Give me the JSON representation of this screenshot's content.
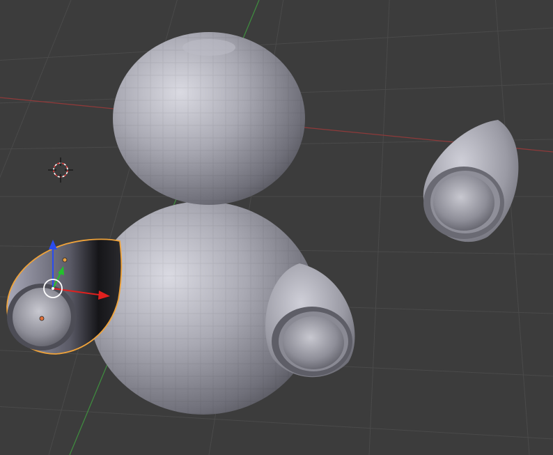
{
  "viewport": {
    "view": "3D Viewport",
    "colors": {
      "background": "#3c3c3c",
      "grid_line": "#4a4a4a",
      "axis_x": "#8e3a3a",
      "axis_y": "#3f8a3f",
      "mesh_light": "#c9c9d2",
      "mesh_mid": "#9c9ca6",
      "mesh_dark": "#55555d",
      "selection_outline": "#f0a33a",
      "gizmo_x": "#e0201e",
      "gizmo_y": "#22c22c",
      "gizmo_z": "#2a4cf0",
      "origin_dot": "#e0703a"
    },
    "objects": [
      {
        "name": "head-sphere",
        "selected": false
      },
      {
        "name": "body-sphere",
        "selected": false
      },
      {
        "name": "ear-right-shell",
        "selected": false
      },
      {
        "name": "ear-middle-shell",
        "selected": false
      },
      {
        "name": "ear-left-shell",
        "selected": true
      }
    ],
    "gizmo": {
      "mode": "translate",
      "axes": [
        "x",
        "y",
        "z"
      ]
    },
    "cursor_3d": {
      "visible": true
    }
  }
}
